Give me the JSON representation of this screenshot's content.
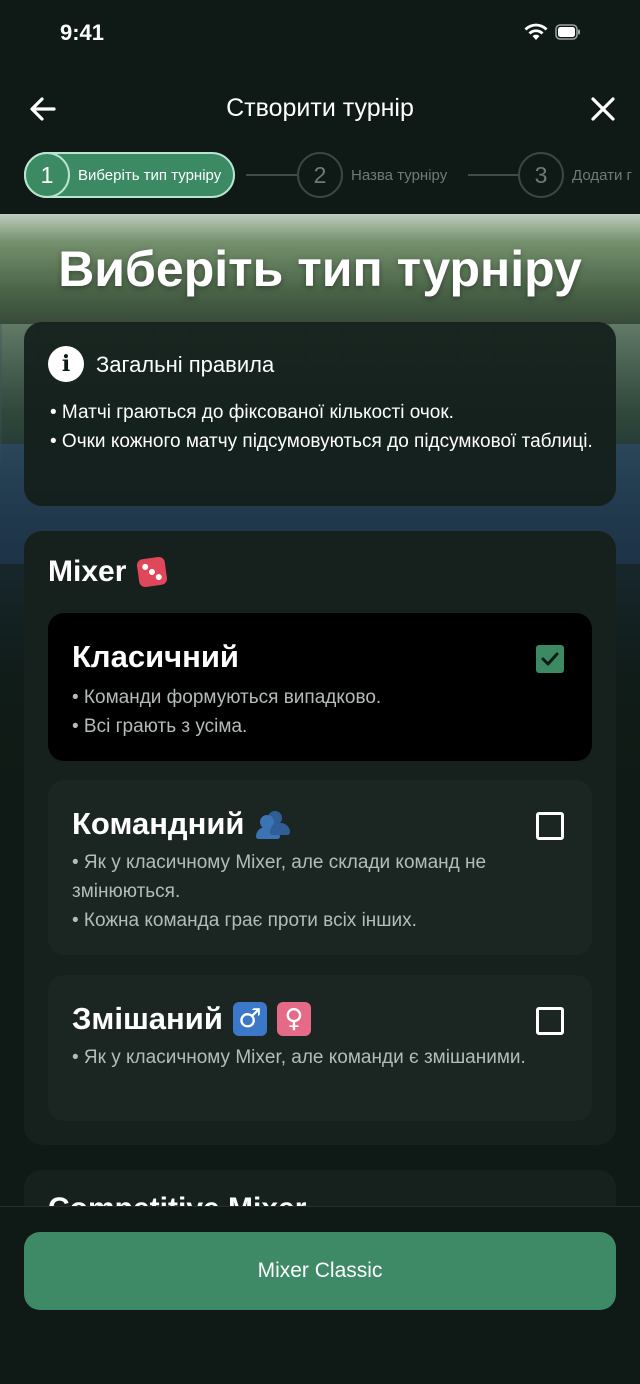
{
  "status_bar": {
    "time": "9:41"
  },
  "nav": {
    "title": "Створити турнір"
  },
  "stepper": {
    "steps": [
      {
        "number": "1",
        "label": "Виберіть тип турніру",
        "active": true
      },
      {
        "number": "2",
        "label": "Назва турніру",
        "active": false
      },
      {
        "number": "3",
        "label": "Додати г",
        "active": false
      }
    ]
  },
  "heading": "Виберіть тип турніру",
  "rules": {
    "title": "Загальні правила",
    "lines": [
      "• Матчі граються до фіксованої кількості очок.",
      "• Очки кожного матчу підсумовуються до підсумкової таблиці."
    ]
  },
  "mixer": {
    "title": "Mixer",
    "icon": "dice-icon",
    "options": [
      {
        "title": "Класичний",
        "checked": true,
        "lines": [
          "• Команди формуються випадково.",
          "• Всі грають з усіма."
        ]
      },
      {
        "title": "Командний",
        "icon": "people-icon",
        "checked": false,
        "lines": [
          "• Як у класичному Mixer, але склади команд не змінюються.",
          "• Кожна команда грає проти всіх інших."
        ]
      },
      {
        "title": "Змішаний",
        "icons": [
          "male-sign-icon",
          "female-sign-icon"
        ],
        "icon_glyphs": [
          "♂",
          "♀"
        ],
        "checked": false,
        "lines": [
          "• Як у класичному Mixer, але команди є змішаними."
        ]
      }
    ]
  },
  "next_section": {
    "title": "Competitive Mixer"
  },
  "footer": {
    "button_label": "Mixer Classic"
  },
  "colors": {
    "accent": "#3f8a66",
    "background": "#0f1a16",
    "card": "#16211d",
    "selected_card": "#000000"
  }
}
